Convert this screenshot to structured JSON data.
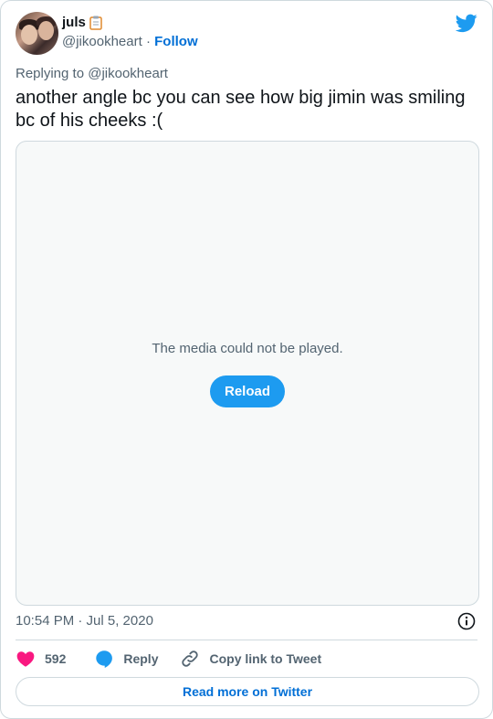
{
  "author": {
    "name": "juls",
    "name_emoji_icon": "clipboard-icon",
    "handle": "@jikookheart",
    "separator": "·",
    "follow_label": "Follow"
  },
  "brand_icon": "twitter-bird-icon",
  "replying_to": "Replying to @jikookheart",
  "tweet_text": "another angle bc you can see how big jimin was smiling bc of his cheeks :(",
  "media": {
    "error_message": "The media could not be played.",
    "reload_label": "Reload"
  },
  "timestamp": "10:54 PM · Jul 5, 2020",
  "actions": {
    "like_count": "592",
    "reply_label": "Reply",
    "copy_link_label": "Copy link to Tweet"
  },
  "read_more_label": "Read more on Twitter",
  "colors": {
    "accent": "#1d9bf0",
    "link": "#006fd6",
    "heart": "#f91880",
    "muted": "#536471",
    "border": "#cfd9de"
  }
}
